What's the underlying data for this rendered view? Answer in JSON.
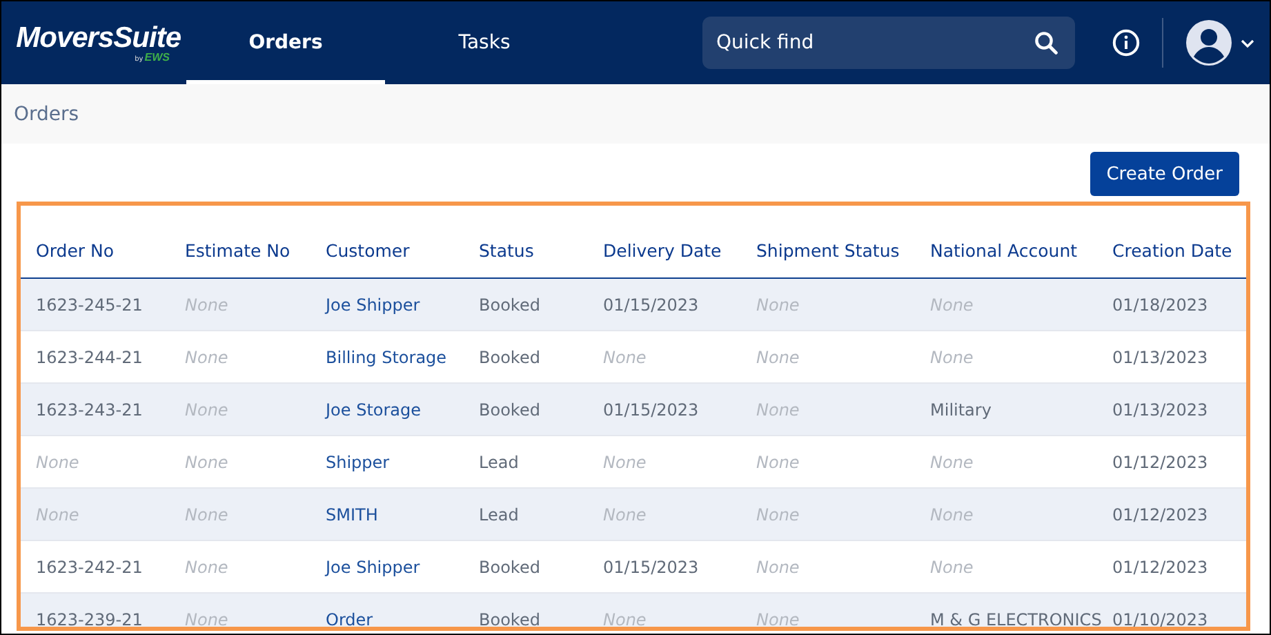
{
  "header": {
    "logo": {
      "name": "MoversSuite",
      "by": "by",
      "brand": "EWS"
    },
    "tabs": [
      {
        "label": "Orders",
        "selected": true
      },
      {
        "label": "Tasks",
        "selected": false
      }
    ],
    "search": {
      "placeholder": "Quick find"
    }
  },
  "breadcrumb": "Orders",
  "toolbar": {
    "create_button": "Create Order"
  },
  "table": {
    "columns": [
      {
        "label": "Order No",
        "kind": "text"
      },
      {
        "label": "Estimate No",
        "kind": "text"
      },
      {
        "label": "Customer",
        "kind": "link"
      },
      {
        "label": "Status",
        "kind": "text"
      },
      {
        "label": "Delivery Date",
        "kind": "text"
      },
      {
        "label": "Shipment Status",
        "kind": "text"
      },
      {
        "label": "National Account",
        "kind": "text"
      },
      {
        "label": "Creation Date",
        "kind": "text"
      }
    ],
    "rows": [
      [
        {
          "text": "1623-245-21",
          "empty": false
        },
        {
          "text": "None",
          "empty": true
        },
        {
          "text": "Joe Shipper",
          "empty": false
        },
        {
          "text": "Booked",
          "empty": false
        },
        {
          "text": "01/15/2023",
          "empty": false
        },
        {
          "text": "None",
          "empty": true
        },
        {
          "text": "None",
          "empty": true
        },
        {
          "text": "01/18/2023",
          "empty": false
        }
      ],
      [
        {
          "text": "1623-244-21",
          "empty": false
        },
        {
          "text": "None",
          "empty": true
        },
        {
          "text": "Billing Storage",
          "empty": false
        },
        {
          "text": "Booked",
          "empty": false
        },
        {
          "text": "None",
          "empty": true
        },
        {
          "text": "None",
          "empty": true
        },
        {
          "text": "None",
          "empty": true
        },
        {
          "text": "01/13/2023",
          "empty": false
        }
      ],
      [
        {
          "text": "1623-243-21",
          "empty": false
        },
        {
          "text": "None",
          "empty": true
        },
        {
          "text": "Joe Storage",
          "empty": false
        },
        {
          "text": "Booked",
          "empty": false
        },
        {
          "text": "01/15/2023",
          "empty": false
        },
        {
          "text": "None",
          "empty": true
        },
        {
          "text": "Military",
          "empty": false
        },
        {
          "text": "01/13/2023",
          "empty": false
        }
      ],
      [
        {
          "text": "None",
          "empty": true
        },
        {
          "text": "None",
          "empty": true
        },
        {
          "text": "Shipper",
          "empty": false
        },
        {
          "text": "Lead",
          "empty": false
        },
        {
          "text": "None",
          "empty": true
        },
        {
          "text": "None",
          "empty": true
        },
        {
          "text": "None",
          "empty": true
        },
        {
          "text": "01/12/2023",
          "empty": false
        }
      ],
      [
        {
          "text": "None",
          "empty": true
        },
        {
          "text": "None",
          "empty": true
        },
        {
          "text": "SMITH",
          "empty": false
        },
        {
          "text": "Lead",
          "empty": false
        },
        {
          "text": "None",
          "empty": true
        },
        {
          "text": "None",
          "empty": true
        },
        {
          "text": "None",
          "empty": true
        },
        {
          "text": "01/12/2023",
          "empty": false
        }
      ],
      [
        {
          "text": "1623-242-21",
          "empty": false
        },
        {
          "text": "None",
          "empty": true
        },
        {
          "text": "Joe Shipper",
          "empty": false
        },
        {
          "text": "Booked",
          "empty": false
        },
        {
          "text": "01/15/2023",
          "empty": false
        },
        {
          "text": "None",
          "empty": true
        },
        {
          "text": "None",
          "empty": true
        },
        {
          "text": "01/12/2023",
          "empty": false
        }
      ],
      [
        {
          "text": "1623-239-21",
          "empty": false
        },
        {
          "text": "None",
          "empty": true
        },
        {
          "text": "Order",
          "empty": false
        },
        {
          "text": "Booked",
          "empty": false
        },
        {
          "text": "None",
          "empty": true
        },
        {
          "text": "None",
          "empty": true
        },
        {
          "text": "M & G ELECTRONICS",
          "empty": false
        },
        {
          "text": "01/10/2023",
          "empty": false
        }
      ]
    ]
  }
}
